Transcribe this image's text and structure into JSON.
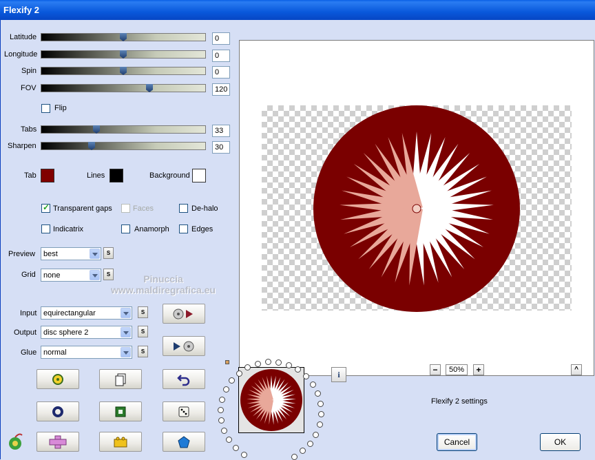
{
  "window": {
    "title": "Flexify 2"
  },
  "sliders": {
    "latitude": {
      "label": "Latitude",
      "value": "0",
      "fraction": 0.5
    },
    "longitude": {
      "label": "Longitude",
      "value": "0",
      "fraction": 0.5
    },
    "spin": {
      "label": "Spin",
      "value": "0",
      "fraction": 0.5
    },
    "fov": {
      "label": "FOV",
      "value": "120",
      "fraction": 0.66
    },
    "tabs": {
      "label": "Tabs",
      "value": "33",
      "fraction": 0.33
    },
    "sharpen": {
      "label": "Sharpen",
      "value": "30",
      "fraction": 0.3
    }
  },
  "flip": {
    "label": "Flip",
    "checked": false
  },
  "colors": {
    "tab": {
      "label": "Tab",
      "color": "#800000"
    },
    "lines": {
      "label": "Lines",
      "color": "#000000"
    },
    "background": {
      "label": "Background",
      "color": "#ffffff"
    }
  },
  "options": {
    "transparent_gaps": {
      "label": "Transparent gaps",
      "checked": true
    },
    "faces": {
      "label": "Faces",
      "checked": false,
      "disabled": true
    },
    "de_halo": {
      "label": "De-halo",
      "checked": false
    },
    "indicatrix": {
      "label": "Indicatrix",
      "checked": false
    },
    "anamorph": {
      "label": "Anamorph",
      "checked": false
    },
    "edges": {
      "label": "Edges",
      "checked": false
    }
  },
  "preview": {
    "label": "Preview",
    "value": "best"
  },
  "grid": {
    "label": "Grid",
    "value": "none"
  },
  "input": {
    "label": "Input",
    "value": "equirectangular"
  },
  "output": {
    "label": "Output",
    "value": "disc sphere 2"
  },
  "glue": {
    "label": "Glue",
    "value": "normal"
  },
  "s_label": "S",
  "watermark": {
    "line1": "Pinuccia",
    "line2": "www.maldiregrafica.eu"
  },
  "zoom": {
    "minus": "−",
    "value": "50%",
    "plus": "+"
  },
  "settings_text": "Flexify 2 settings",
  "buttons": {
    "cancel": "Cancel",
    "ok": "OK",
    "info": "i",
    "collapse": "^"
  },
  "image_color": "#7a0000"
}
